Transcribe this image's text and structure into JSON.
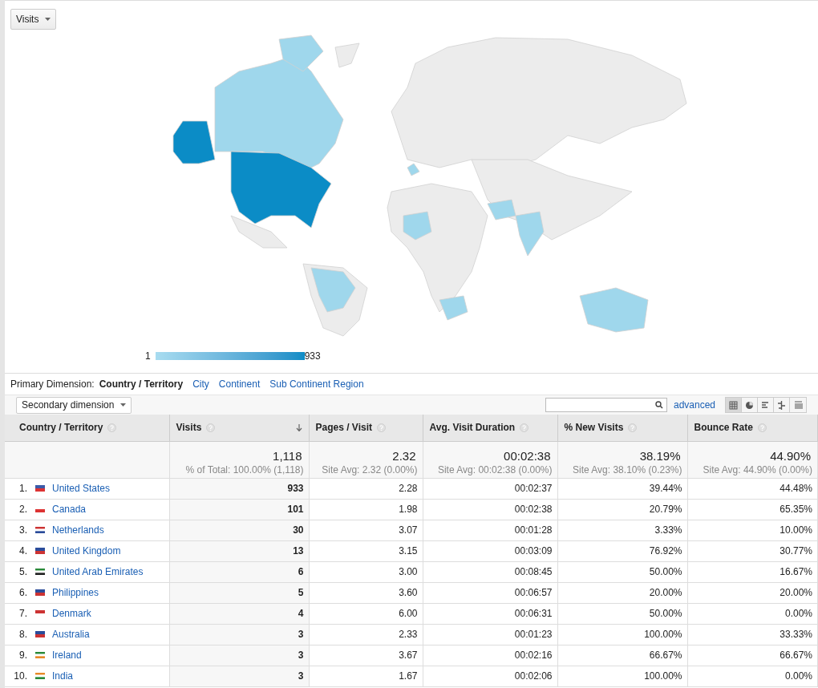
{
  "metric_dropdown": {
    "label": "Visits"
  },
  "map": {
    "legend": {
      "min": "1",
      "max": "933"
    }
  },
  "primary_dimension": {
    "label": "Primary Dimension:",
    "options": [
      {
        "label": "Country / Territory",
        "selected": true
      },
      {
        "label": "City",
        "selected": false
      },
      {
        "label": "Continent",
        "selected": false
      },
      {
        "label": "Sub Continent Region",
        "selected": false
      }
    ]
  },
  "secondary_dimension": {
    "label": "Secondary dimension"
  },
  "advanced_link": "advanced",
  "views": [
    {
      "kind": "table",
      "selected": true
    },
    {
      "kind": "pie",
      "selected": false
    },
    {
      "kind": "bar",
      "selected": false
    },
    {
      "kind": "compare",
      "selected": false
    },
    {
      "kind": "pivot",
      "selected": false
    }
  ],
  "table": {
    "columns": [
      {
        "label": "Country / Territory",
        "sorted": false
      },
      {
        "label": "Visits",
        "sorted": true
      },
      {
        "label": "Pages / Visit",
        "sorted": false
      },
      {
        "label": "Avg. Visit Duration",
        "sorted": false
      },
      {
        "label": "% New Visits",
        "sorted": false
      },
      {
        "label": "Bounce Rate",
        "sorted": false
      }
    ],
    "totals": [
      {
        "value": "1,118",
        "note": "% of Total: 100.00% (1,118)"
      },
      {
        "value": "2.32",
        "note": "Site Avg: 2.32 (0.00%)"
      },
      {
        "value": "00:02:38",
        "note": "Site Avg: 00:02:38 (0.00%)"
      },
      {
        "value": "38.19%",
        "note": "Site Avg: 38.10% (0.23%)"
      },
      {
        "value": "44.90%",
        "note": "Site Avg: 44.90% (0.00%)"
      }
    ],
    "rows": [
      {
        "rank": "1.",
        "cells": [
          "United States",
          "933",
          "2.28",
          "00:02:37",
          "39.44%",
          "44.48%"
        ]
      },
      {
        "rank": "2.",
        "cells": [
          "Canada",
          "101",
          "1.98",
          "00:02:38",
          "20.79%",
          "65.35%"
        ]
      },
      {
        "rank": "3.",
        "cells": [
          "Netherlands",
          "30",
          "3.07",
          "00:01:28",
          "3.33%",
          "10.00%"
        ]
      },
      {
        "rank": "4.",
        "cells": [
          "United Kingdom",
          "13",
          "3.15",
          "00:03:09",
          "76.92%",
          "30.77%"
        ]
      },
      {
        "rank": "5.",
        "cells": [
          "United Arab Emirates",
          "6",
          "3.00",
          "00:08:45",
          "50.00%",
          "16.67%"
        ]
      },
      {
        "rank": "6.",
        "cells": [
          "Philippines",
          "5",
          "3.60",
          "00:06:57",
          "20.00%",
          "20.00%"
        ]
      },
      {
        "rank": "7.",
        "cells": [
          "Denmark",
          "4",
          "6.00",
          "00:06:31",
          "50.00%",
          "0.00%"
        ]
      },
      {
        "rank": "8.",
        "cells": [
          "Australia",
          "3",
          "2.33",
          "00:01:23",
          "100.00%",
          "33.33%"
        ]
      },
      {
        "rank": "9.",
        "cells": [
          "Ireland",
          "3",
          "3.67",
          "00:02:16",
          "66.67%",
          "66.67%"
        ]
      },
      {
        "rank": "10.",
        "cells": [
          "India",
          "3",
          "1.67",
          "00:02:06",
          "100.00%",
          "0.00%"
        ]
      }
    ]
  }
}
